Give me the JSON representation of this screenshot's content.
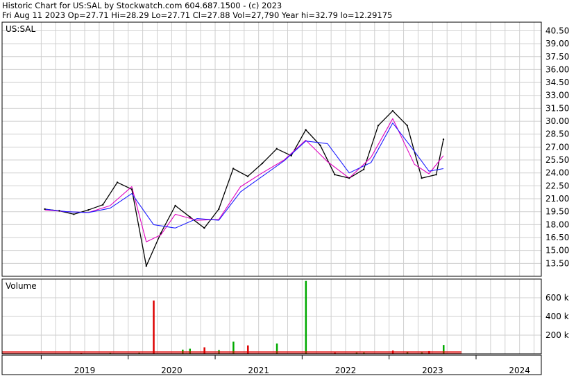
{
  "header": {
    "line1": "Historic Chart for US:SAL by Stockwatch.com 604.687.1500 - (c) 2023",
    "line2": "Fri Aug 11 2023   Op=27.71  Hi=28.29  Lo=27.71  Cl=27.88  Vol=27,790   Year hi=32.79   lo=12.29175"
  },
  "price_panel": {
    "symbol": "US:SAL"
  },
  "volume_panel": {
    "label": "Volume"
  },
  "colors": {
    "grid": "#cfcfcf",
    "price": "#000000",
    "ma_short": "#e000c0",
    "ma_long": "#1a1aff",
    "vol_up": "#00aa00",
    "vol_down": "#dd0000"
  },
  "chart_data": [
    {
      "type": "line",
      "title": "US:SAL",
      "y_scale": "linear",
      "ylim": [
        12.0,
        41.5
      ],
      "y_ticks": [
        "40.50",
        "39.00",
        "37.50",
        "36.00",
        "34.50",
        "33.00",
        "31.50",
        "30.00",
        "28.50",
        "27.00",
        "25.50",
        "24.00",
        "22.50",
        "21.00",
        "19.50",
        "18.00",
        "16.50",
        "15.00",
        "13.50"
      ],
      "x_labels": [
        "2019",
        "2020",
        "2021",
        "2022",
        "2023",
        "2024"
      ],
      "grid": true,
      "series": [
        {
          "x": [
            "2019-01",
            "2019-03",
            "2019-05",
            "2019-07",
            "2019-09",
            "2019-11",
            "2020-01",
            "2020-03",
            "2020-05",
            "2020-07",
            "2020-09",
            "2020-11",
            "2021-01",
            "2021-03",
            "2021-05",
            "2021-07",
            "2021-09",
            "2021-11",
            "2022-01",
            "2022-03",
            "2022-05",
            "2022-07",
            "2022-09",
            "2022-11",
            "2023-01",
            "2023-03",
            "2023-05",
            "2023-07",
            "2023-08"
          ],
          "values": [
            19.8,
            19.6,
            19.2,
            19.7,
            20.3,
            22.9,
            22.1,
            13.2,
            17.0,
            20.2,
            18.9,
            17.6,
            19.8,
            24.5,
            23.6,
            25.1,
            26.8,
            26.0,
            29.0,
            27.2,
            23.8,
            23.4,
            24.4,
            29.5,
            31.2,
            29.5,
            23.4,
            23.8,
            27.9
          ]
        },
        {
          "x": [
            "2019-01",
            "2019-04",
            "2019-07",
            "2019-10",
            "2020-01",
            "2020-03",
            "2020-05",
            "2020-07",
            "2020-10",
            "2021-01",
            "2021-04",
            "2021-07",
            "2021-10",
            "2022-01",
            "2022-04",
            "2022-07",
            "2022-10",
            "2023-01",
            "2023-04",
            "2023-06",
            "2023-08"
          ],
          "values": [
            19.7,
            19.5,
            19.4,
            20.2,
            22.4,
            16.0,
            16.8,
            19.2,
            18.5,
            18.6,
            22.4,
            24.0,
            25.5,
            27.8,
            25.3,
            23.4,
            25.8,
            30.3,
            25.0,
            23.9,
            26.0
          ]
        },
        {
          "x": [
            "2019-01",
            "2019-04",
            "2019-07",
            "2019-10",
            "2020-01",
            "2020-04",
            "2020-07",
            "2020-10",
            "2021-01",
            "2021-04",
            "2021-07",
            "2021-10",
            "2022-01",
            "2022-04",
            "2022-07",
            "2022-10",
            "2023-01",
            "2023-04",
            "2023-06",
            "2023-08"
          ],
          "values": [
            19.8,
            19.5,
            19.4,
            19.9,
            21.6,
            18.0,
            17.6,
            18.7,
            18.5,
            21.8,
            23.6,
            25.4,
            27.7,
            27.4,
            24.0,
            25.2,
            29.8,
            26.5,
            24.2,
            24.5
          ]
        }
      ]
    },
    {
      "type": "bar",
      "title": "Volume",
      "ylim": [
        0,
        800
      ],
      "y_ticks": [
        "600 k",
        "400 k",
        "200 k"
      ],
      "grid": true,
      "categories": [
        "2019-06",
        "2019-10",
        "2020-02",
        "2020-04",
        "2020-08",
        "2020-09",
        "2020-11",
        "2021-01",
        "2021-03",
        "2021-05",
        "2021-09",
        "2022-01",
        "2022-05",
        "2022-08",
        "2022-09",
        "2023-01",
        "2023-03",
        "2023-05",
        "2023-06",
        "2023-08"
      ],
      "values": [
        8,
        10,
        12,
        570,
        45,
        55,
        70,
        40,
        130,
        90,
        110,
        780,
        15,
        15,
        15,
        35,
        22,
        18,
        30,
        95
      ]
    }
  ]
}
